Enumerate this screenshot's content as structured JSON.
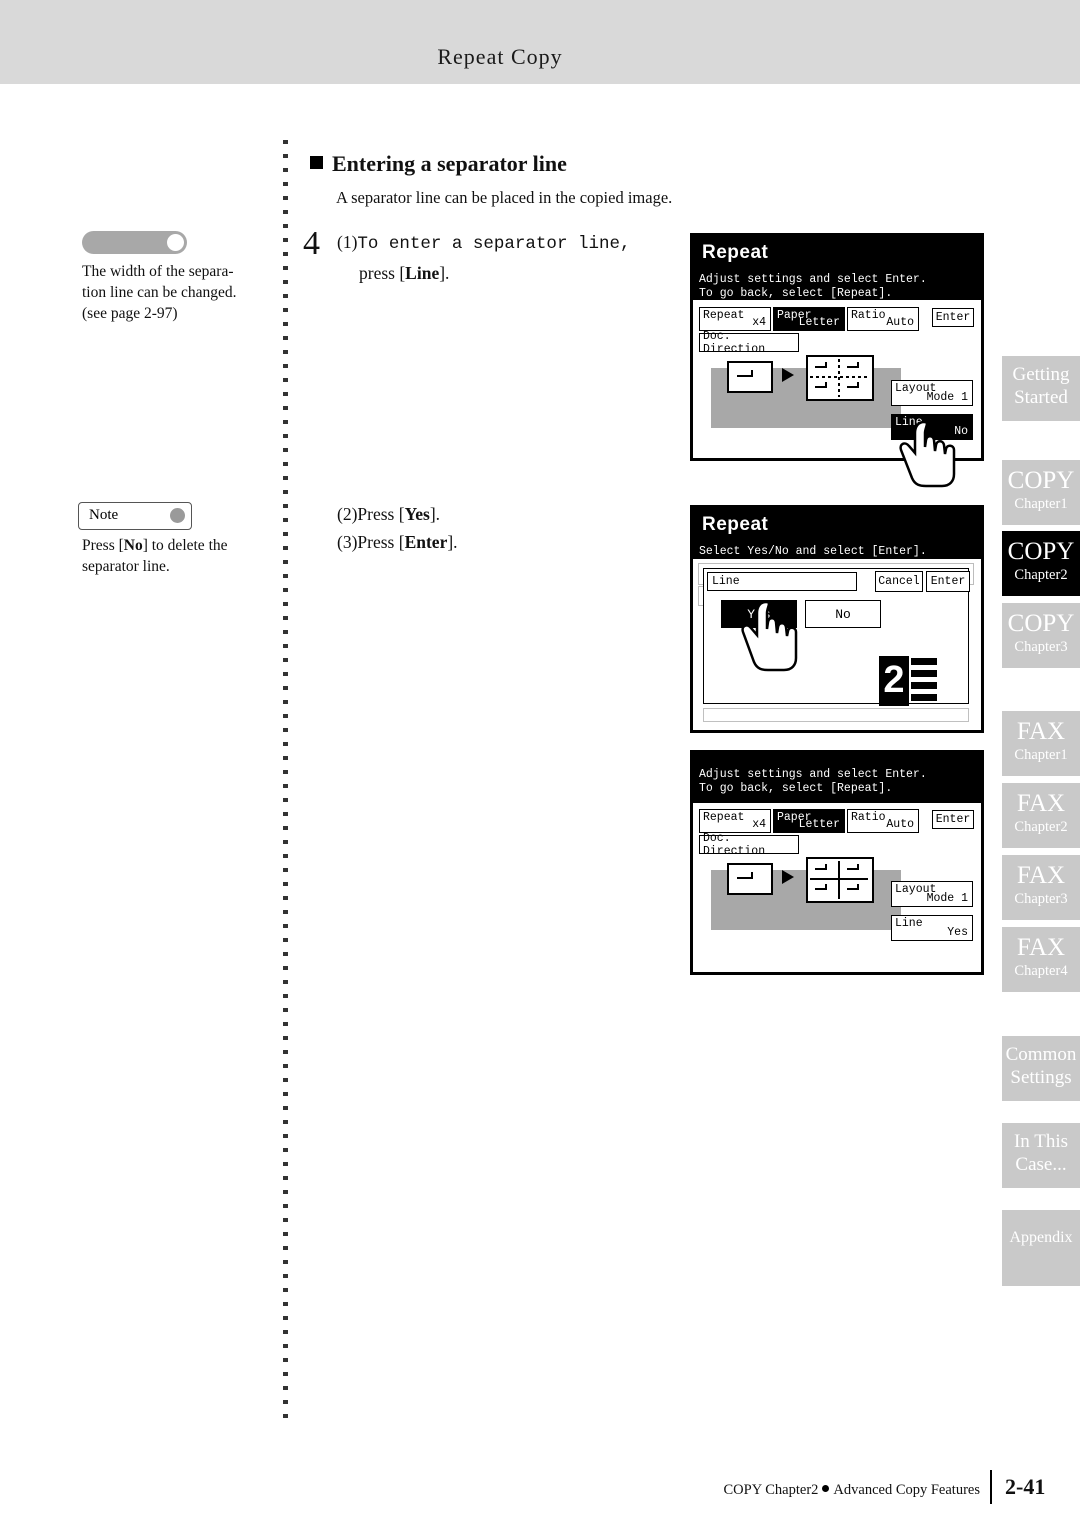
{
  "header": {
    "title": "Repeat Copy"
  },
  "left": {
    "note_width": "The width of the separa-tion line can be changed. (see page 2-97)",
    "note_width_lines": [
      "The width of the separa-",
      "tion line can be changed.",
      "(see page 2-97)"
    ],
    "note_label": "Note",
    "note_body_lines": [
      "Press [No] to delete the",
      "separator line."
    ],
    "note_body_pre": "Press [",
    "note_body_bold": "No",
    "note_body_post": "] to delete the separator line."
  },
  "main": {
    "section_title": "Entering a separator line",
    "section_sub": "A separator line can be placed in the copied image.",
    "step_number": "4",
    "step_1_index": "(1)",
    "step_1_line1": "To enter a separator line,",
    "step_1_line2_pre": "press [",
    "step_1_line2_bold": "Line",
    "step_1_line2_post": "].",
    "step_2_index": "(2)",
    "step_2_pre": "Press [",
    "step_2_bold": "Yes",
    "step_2_post": "].",
    "step_3_index": "(3)",
    "step_3_pre": "Press [",
    "step_3_bold": "Enter",
    "step_3_post": "]."
  },
  "lcd1": {
    "title": "Repeat",
    "msg_line1": "Adjust settings and select Enter.",
    "msg_line2": "To go back, select [Repeat].",
    "btn_repeat_label": "Repeat",
    "btn_repeat_value": "x4",
    "btn_paper_label": "Paper",
    "btn_paper_value": "Letter",
    "btn_ratio_label": "Ratio",
    "btn_ratio_value": "Auto",
    "btn_enter": "Enter",
    "btn_doc_direction": "Doc. Direction",
    "btn_layout_label": "Layout",
    "btn_layout_value": "Mode 1",
    "btn_line_label": "Line",
    "btn_line_value": "No"
  },
  "lcd2": {
    "title": "Repeat",
    "msg_line1": "Select Yes/No and select [Enter].",
    "field_label": "Line",
    "btn_cancel": "Cancel",
    "btn_enter": "Enter",
    "btn_yes": "Yes",
    "btn_no": "No"
  },
  "lcd3": {
    "msg_line1": "Adjust settings and select Enter.",
    "msg_line2": "To go back, select [Repeat].",
    "btn_repeat_label": "Repeat",
    "btn_repeat_value": "x4",
    "btn_paper_label": "Paper",
    "btn_paper_value": "Letter",
    "btn_ratio_label": "Ratio",
    "btn_ratio_value": "Auto",
    "btn_enter": "Enter",
    "btn_doc_direction": "Doc. Direction",
    "btn_layout_label": "Layout",
    "btn_layout_value": "Mode 1",
    "btn_line_label": "Line",
    "btn_line_value": "Yes"
  },
  "tabs": [
    {
      "t1": "Getting",
      "t2": "Started",
      "style": "light"
    },
    {
      "t1": "COPY",
      "t2": "Chapter1",
      "style": "light"
    },
    {
      "t1": "COPY",
      "t2": "Chapter2",
      "style": "dark"
    },
    {
      "t1": "COPY",
      "t2": "Chapter3",
      "style": "light"
    },
    {
      "t1": "FAX",
      "t2": "Chapter1",
      "style": "light"
    },
    {
      "t1": "FAX",
      "t2": "Chapter2",
      "style": "light"
    },
    {
      "t1": "FAX",
      "t2": "Chapter3",
      "style": "light"
    },
    {
      "t1": "FAX",
      "t2": "Chapter4",
      "style": "light"
    },
    {
      "t1": "Common",
      "t2": "Settings",
      "style": "light"
    },
    {
      "t1": "In This",
      "t2": "Case...",
      "style": "light"
    },
    {
      "t1": "Appendix",
      "t2": "",
      "style": "light"
    }
  ],
  "footer": {
    "text_pre": "COPY Chapter2",
    "text_post": "Advanced Copy Features",
    "page": "2-41"
  },
  "colors": {
    "header_band": "#d9d9d9",
    "tab_inactive": "#c9c9c9",
    "tab_active": "#000000",
    "gray_area": "#a8a8a8"
  }
}
